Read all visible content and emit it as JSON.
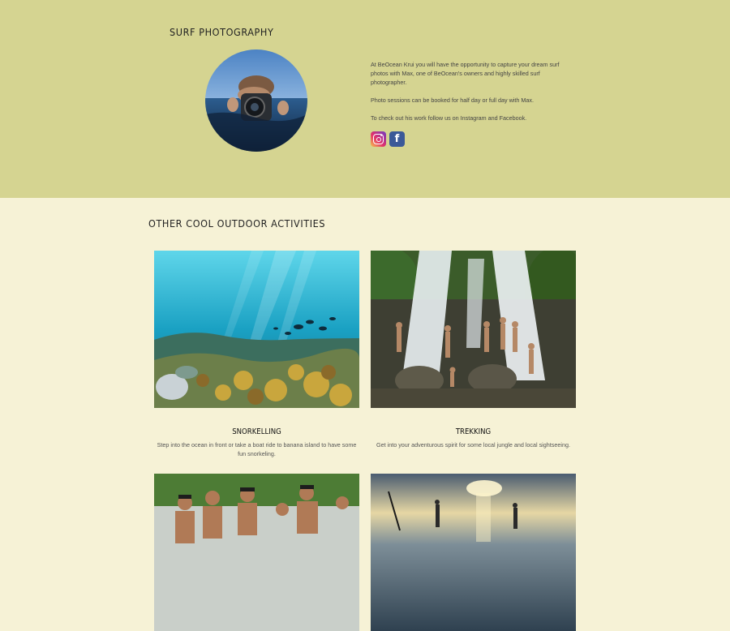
{
  "surf": {
    "title": "SURF PHOTOGRAPHY",
    "para1": "At BeOcean Krui you will have the opportunity to capture your dream surf photos with Max, one of BeOcean's owners and highly skilled surf photographer.",
    "para2": "Photo sessions can be booked for half day or full day with Max.",
    "para3": "To check out his work follow us on Instagram and Facebook.",
    "facebook_glyph": "f"
  },
  "activities": {
    "title": "OTHER COOL OUTDOOR ACTIVITIES",
    "cards": [
      {
        "title": "SNORKELLING",
        "text": "Step into the ocean in front or take a boat ride to banana island to have some fun snorkeling."
      },
      {
        "title": "TREKKING",
        "text": "Get into your adventurous spirit for some local jungle and local sightseeing."
      }
    ]
  },
  "colors": {
    "surf_bg": "#d5d491",
    "page_bg": "#f6f2d6"
  }
}
